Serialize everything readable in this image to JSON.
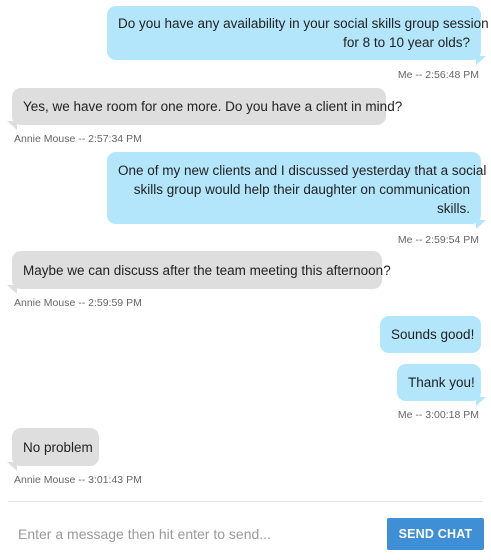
{
  "chat": {
    "messages": [
      {
        "from": "me",
        "lines": [
          "Do you have any availability in your social skills group session",
          "for 8 to 10 year olds?"
        ],
        "meta": "Me -- 2:56:48 PM"
      },
      {
        "from": "them",
        "lines": [
          "Yes, we have room for one more. Do you have a client in mind?"
        ],
        "meta": "Annie Mouse -- 2:57:34 PM"
      },
      {
        "from": "me",
        "lines": [
          "One of my new clients and I discussed yesterday that a social",
          "skills group would help their daughter on communication",
          "skills."
        ],
        "meta": "Me -- 2:59:54 PM"
      },
      {
        "from": "them",
        "lines": [
          "Maybe we can discuss after the team meeting this afternoon?"
        ],
        "meta": "Annie Mouse -- 2:59:59 PM"
      },
      {
        "from": "me",
        "lines": [
          "Sounds good!"
        ],
        "meta": ""
      },
      {
        "from": "me",
        "lines": [
          "Thank you!"
        ],
        "meta": "Me -- 3:00:18 PM"
      },
      {
        "from": "them",
        "lines": [
          "No problem"
        ],
        "meta": "Annie Mouse -- 3:01:43 PM"
      }
    ]
  },
  "composer": {
    "placeholder": "Enter a message then hit enter to send...",
    "value": "",
    "send_label": "SEND CHAT"
  },
  "colors": {
    "my_bubble": "#b3e5fb",
    "their_bubble": "#dedede",
    "send_button": "#3f8fd6"
  }
}
